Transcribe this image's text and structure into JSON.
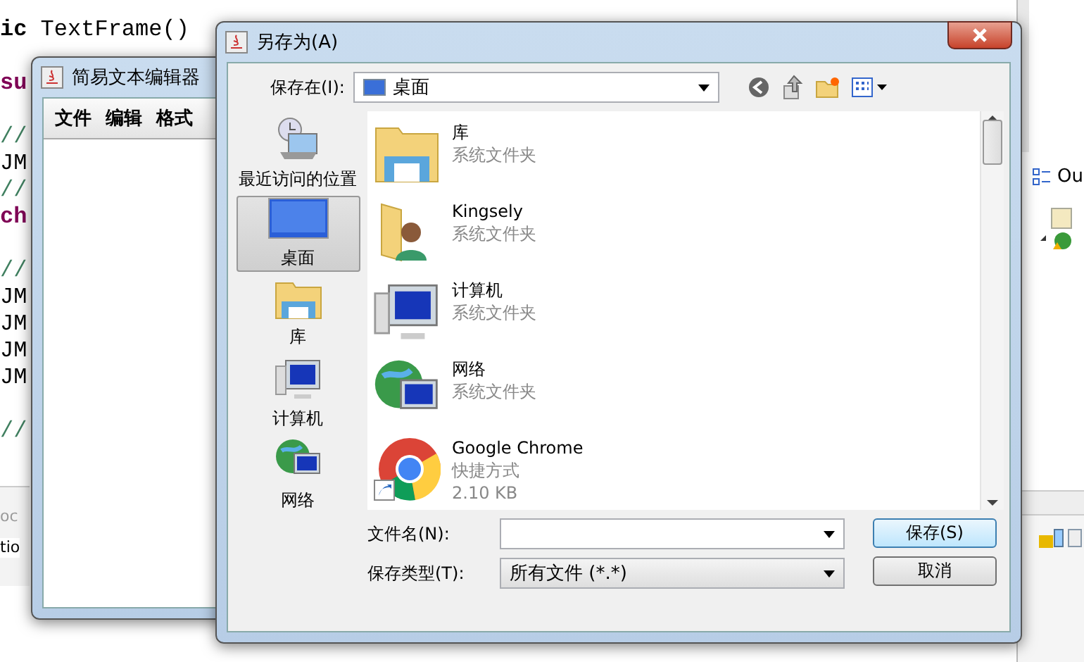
{
  "ide": {
    "code_lines": [
      {
        "kind": "mixed",
        "text": "**ic** TextFrame()"
      },
      {
        "kind": "blank"
      },
      {
        "kind": "keyword",
        "text": "su"
      },
      {
        "kind": "blank"
      },
      {
        "kind": "comment",
        "text": "//"
      },
      {
        "kind": "code",
        "text": "JM"
      },
      {
        "kind": "comment",
        "text": "//"
      },
      {
        "kind": "keyword",
        "text": "ch"
      },
      {
        "kind": "blank"
      },
      {
        "kind": "comment",
        "text": "//"
      },
      {
        "kind": "code",
        "text": "JM"
      },
      {
        "kind": "code",
        "text": "JM"
      },
      {
        "kind": "code",
        "text": "JM"
      },
      {
        "kind": "code",
        "text": "JM"
      },
      {
        "kind": "blank"
      },
      {
        "kind": "comment",
        "text": "//"
      }
    ],
    "bottom_panel": {
      "tab": "oc",
      "row": "tio"
    },
    "outline_panel": {
      "title": "Ou"
    }
  },
  "editor_window": {
    "title": "简易文本编辑器",
    "menu": [
      "文件",
      "编辑",
      "格式"
    ]
  },
  "save_dialog": {
    "title": "另存为(A)",
    "save_in": {
      "label": "保存在(I):",
      "value": "桌面"
    },
    "places": [
      {
        "kind": "recent",
        "label": "最近访问的位置",
        "selected": false
      },
      {
        "kind": "desktop",
        "label": "桌面",
        "selected": true
      },
      {
        "kind": "library",
        "label": "库",
        "selected": false
      },
      {
        "kind": "computer",
        "label": "计算机",
        "selected": false
      },
      {
        "kind": "network",
        "label": "网络",
        "selected": false
      }
    ],
    "files": [
      {
        "kind": "library",
        "name": "库",
        "details": [
          "系统文件夹"
        ]
      },
      {
        "kind": "user",
        "name": "Kingsely",
        "details": [
          "系统文件夹"
        ]
      },
      {
        "kind": "computer",
        "name": "计算机",
        "details": [
          "系统文件夹"
        ]
      },
      {
        "kind": "network",
        "name": "网络",
        "details": [
          "系统文件夹"
        ]
      },
      {
        "kind": "shortcut",
        "name": "Google Chrome",
        "details": [
          "快捷方式",
          "2.10 KB"
        ]
      }
    ],
    "file_name": {
      "label": "文件名(N):"
    },
    "file_type": {
      "label": "保存类型(T):",
      "value": "所有文件 (*.*)"
    },
    "buttons": [
      {
        "kind": "primary",
        "label": "保存(S)"
      },
      {
        "kind": "normal",
        "label": "取消"
      }
    ]
  }
}
